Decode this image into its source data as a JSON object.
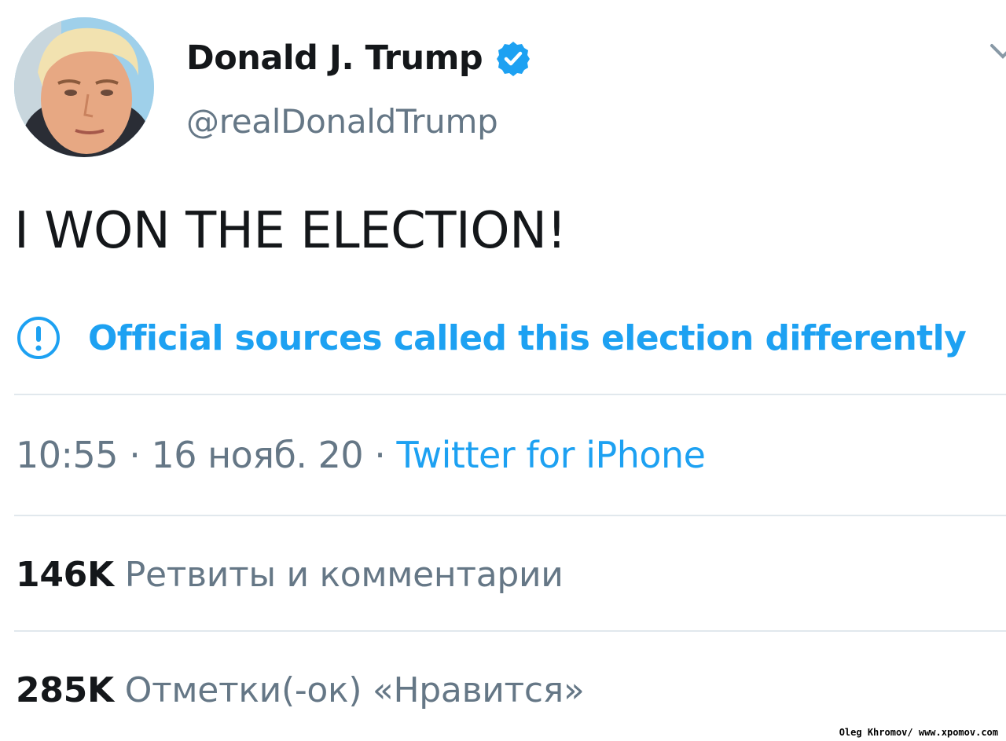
{
  "user": {
    "display_name": "Donald J. Trump",
    "handle": "@realDonaldTrump",
    "verified": true,
    "verified_icon": "verified-badge-icon"
  },
  "tweet": {
    "text": "I WON THE ELECTION!"
  },
  "notice": {
    "icon": "exclamation-circle-icon",
    "text": "Official sources called this election differently"
  },
  "meta": {
    "time": "10:55",
    "separator": "·",
    "date": "16 нояб. 20",
    "source": "Twitter for iPhone"
  },
  "stats": {
    "retweets_count": "146K",
    "retweets_label": "Ретвиты и комментарии",
    "likes_count": "285K",
    "likes_label": "Отметки(-ок) «Нравится»"
  },
  "watermark": "Oleg Khromov/  www.xpomov.com",
  "colors": {
    "accent": "#1da1f2",
    "secondary_text": "#657786",
    "primary_text": "#14171a",
    "divider": "#e1e8ed"
  }
}
